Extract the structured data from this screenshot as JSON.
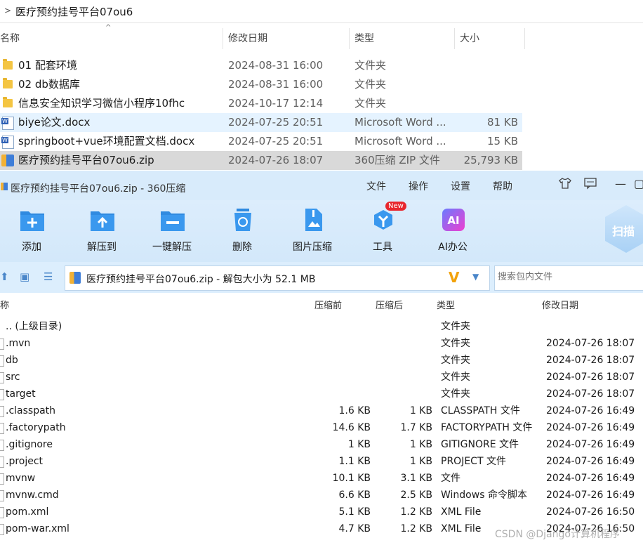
{
  "explorer": {
    "path": "医疗预约挂号平台07ou6",
    "columns": {
      "name": "名称",
      "date": "修改日期",
      "type": "类型",
      "size": "大小"
    },
    "files": [
      {
        "name": "01 配套环境",
        "date": "2024-08-31 16:00",
        "type": "文件夹",
        "size": "",
        "icon": "folder-icon"
      },
      {
        "name": "02 db数据库",
        "date": "2024-08-31 16:00",
        "type": "文件夹",
        "size": "",
        "icon": "folder-icon"
      },
      {
        "name": "信息安全知识学习微信小程序10fhc",
        "date": "2024-10-17 12:14",
        "type": "文件夹",
        "size": "",
        "icon": "folder-icon"
      },
      {
        "name": "biye论文.docx",
        "date": "2024-07-25 20:51",
        "type": "Microsoft Word ...",
        "size": "81 KB",
        "icon": "word-doc-icon"
      },
      {
        "name": "springboot+vue环境配置文档.docx",
        "date": "2024-07-25 20:51",
        "type": "Microsoft Word ...",
        "size": "15 KB",
        "icon": "word-doc-icon"
      },
      {
        "name": "医疗预约挂号平台07ou6.zip",
        "date": "2024-07-26 18:07",
        "type": "360压缩 ZIP 文件",
        "size": "25,793 KB",
        "icon": "zip-icon"
      }
    ]
  },
  "zip": {
    "title": "医疗预约挂号平台07ou6.zip - 360压缩",
    "menu": [
      "文件",
      "操作",
      "设置",
      "帮助"
    ],
    "tools": [
      {
        "label": "添加",
        "icon": "add-icon"
      },
      {
        "label": "解压到",
        "icon": "extract-to-icon"
      },
      {
        "label": "一键解压",
        "icon": "one-click-extract-icon"
      },
      {
        "label": "删除",
        "icon": "delete-icon"
      },
      {
        "label": "图片压缩",
        "icon": "image-compress-icon"
      },
      {
        "label": "工具",
        "icon": "tools-icon"
      },
      {
        "label": "AI办公",
        "icon": "ai-office-icon"
      }
    ],
    "new_badge": "New",
    "scan_label": "扫描",
    "path_text": "医疗预约挂号平台07ou6.zip - 解包大小为 52.1 MB",
    "search_placeholder": "搜索包内文件",
    "columns": {
      "name": "称",
      "before": "压缩前",
      "after": "压缩后",
      "type": "类型",
      "date": "修改日期"
    },
    "entries": [
      {
        "name": ".. (上级目录)",
        "before": "",
        "after": "",
        "type": "文件夹",
        "date": ""
      },
      {
        "name": ".mvn",
        "before": "",
        "after": "",
        "type": "文件夹",
        "date": "2024-07-26 18:07"
      },
      {
        "name": "db",
        "before": "",
        "after": "",
        "type": "文件夹",
        "date": "2024-07-26 18:07"
      },
      {
        "name": "src",
        "before": "",
        "after": "",
        "type": "文件夹",
        "date": "2024-07-26 18:07"
      },
      {
        "name": "target",
        "before": "",
        "after": "",
        "type": "文件夹",
        "date": "2024-07-26 18:07"
      },
      {
        "name": ".classpath",
        "before": "1.6 KB",
        "after": "1 KB",
        "type": "CLASSPATH 文件",
        "date": "2024-07-26 16:49"
      },
      {
        "name": ".factorypath",
        "before": "14.6 KB",
        "after": "1.7 KB",
        "type": "FACTORYPATH 文件",
        "date": "2024-07-26 16:49"
      },
      {
        "name": ".gitignore",
        "before": "1 KB",
        "after": "1 KB",
        "type": "GITIGNORE 文件",
        "date": "2024-07-26 16:49"
      },
      {
        "name": ".project",
        "before": "1.1 KB",
        "after": "1 KB",
        "type": "PROJECT 文件",
        "date": "2024-07-26 16:49"
      },
      {
        "name": "mvnw",
        "before": "10.1 KB",
        "after": "3.1 KB",
        "type": "文件",
        "date": "2024-07-26 16:49"
      },
      {
        "name": "mvnw.cmd",
        "before": "6.6 KB",
        "after": "2.5 KB",
        "type": "Windows 命令脚本",
        "date": "2024-07-26 16:49"
      },
      {
        "name": "pom.xml",
        "before": "5.1 KB",
        "after": "1.2 KB",
        "type": "XML File",
        "date": "2024-07-26 16:50"
      },
      {
        "name": "pom-war.xml",
        "before": "4.7 KB",
        "after": "1.2 KB",
        "type": "XML File",
        "date": "2024-07-26 16:50"
      }
    ]
  },
  "watermark": "CSDN @Django计算机程序",
  "colors": {
    "selection": "#e5f3ff",
    "zip_selected": "#d9d9d9",
    "toolbar_bg": "#d8ebfb",
    "accent": "#2f8ae0"
  }
}
